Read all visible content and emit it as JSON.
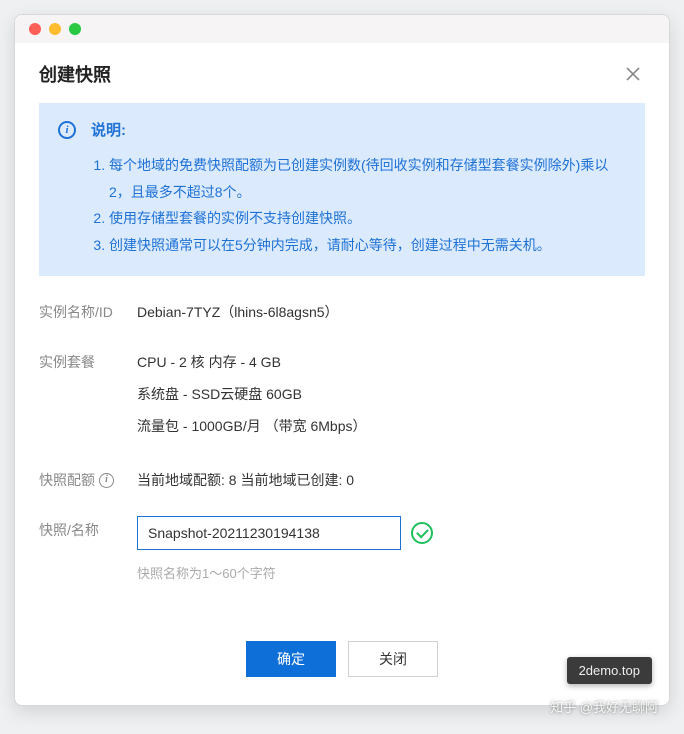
{
  "dialog": {
    "title": "创建快照",
    "close_aria": "关闭"
  },
  "info": {
    "title": "说明:",
    "items": [
      "每个地域的免费快照配额为已创建实例数(待回收实例和存储型套餐实例除外)乘以2，且最多不超过8个。",
      "使用存储型套餐的实例不支持创建快照。",
      "创建快照通常可以在5分钟内完成，请耐心等待，创建过程中无需关机。"
    ]
  },
  "fields": {
    "instance_label": "实例名称/ID",
    "instance_value": "Debian-7TYZ（lhins-6l8agsn5）",
    "plan_label": "实例套餐",
    "plan_cpu": "CPU - 2 核 内存 - 4 GB",
    "plan_disk": "系统盘 - SSD云硬盘 60GB",
    "plan_traffic": "流量包 - 1000GB/月 （带宽 6Mbps）",
    "quota_label": "快照配额",
    "quota_value": "当前地域配额: 8 当前地域已创建: 0",
    "name_label": "快照/名称",
    "name_value": "Snapshot-20211230194138",
    "name_hint": "快照名称为1～60个字符"
  },
  "buttons": {
    "confirm": "确定",
    "cancel": "关闭"
  },
  "tooltip": "2demo.top",
  "watermark": "知乎 @我好无聊阿"
}
